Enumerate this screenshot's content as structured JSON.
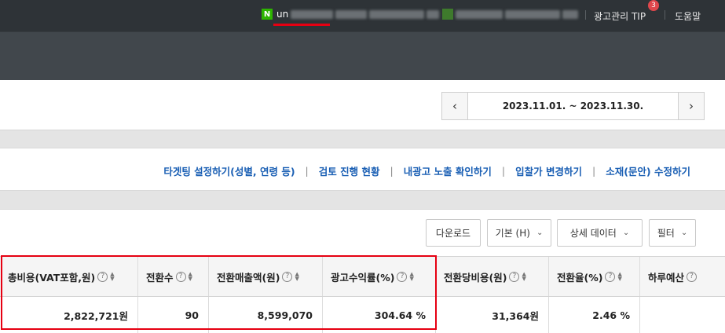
{
  "topbar": {
    "account_prefix": "un",
    "ad_tip": "광고관리 TIP",
    "tip_badge": "3",
    "help": "도움말",
    "naver_badge": "N"
  },
  "date_range": {
    "prev_icon": "‹",
    "next_icon": "›",
    "value": "2023.11.01. ~ 2023.11.30."
  },
  "links": [
    "타겟팅 설정하기(성별, 연령 등)",
    "검토 진행 현황",
    "내광고 노출 확인하기",
    "입찰가 변경하기",
    "소재(문안) 수정하기"
  ],
  "link_separator": "|",
  "controls": {
    "download": "다운로드",
    "basic": "기본 (H)",
    "detail": "상세 데이터",
    "filter": "필터"
  },
  "table": {
    "headers": [
      "총비용(VAT포함,원)",
      "전환수",
      "전환매출액(원)",
      "광고수익률(%)",
      "전환당비용(원)",
      "전환율(%)",
      "하루예산"
    ],
    "row": [
      "2,822,721원",
      "90",
      "8,599,070",
      "304.64 %",
      "31,364원",
      "2.46 %",
      ""
    ]
  },
  "colors": {
    "highlight": "#e60012",
    "link": "#1a5fb4",
    "topbar": "#2e3337"
  }
}
